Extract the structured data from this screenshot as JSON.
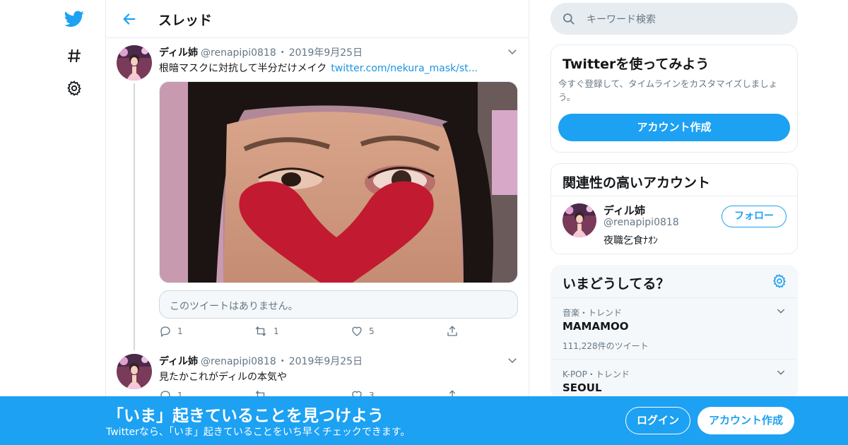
{
  "nav": {
    "icons": [
      "twitter-bird-icon",
      "hashtag-icon",
      "gear-icon"
    ]
  },
  "header": {
    "title": "スレッド"
  },
  "tweets": [
    {
      "name": "ディル姉",
      "handle": "@renapipi0818",
      "separator": "・",
      "date": "2019年9月25日",
      "text": "根暗マスクに対抗して半分だけメイク",
      "link": "twitter.com/nekura_mask/st...",
      "quote_unavailable": "このツイートはありません。",
      "replies": "1",
      "retweets": "1",
      "likes": "5"
    },
    {
      "name": "ディル姉",
      "handle": "@renapipi0818",
      "separator": "・",
      "date": "2019年9月25日",
      "text": "見たかこれがディルの本気や",
      "replies": "1",
      "retweets": "",
      "likes": "3"
    }
  ],
  "search": {
    "placeholder": "キーワード検索"
  },
  "signup_card": {
    "title": "Twitterを使ってみよう",
    "desc_line1": "今すぐ登録して、タイムラインをカスタマイズしましょ",
    "desc_line2": "う。",
    "button": "アカウント作成"
  },
  "related": {
    "title": "関連性の高いアカウント",
    "account": {
      "name": "ディル姉",
      "handle": "@renapipi0818",
      "bio": "夜職乞食ﾅｵﾝ",
      "follow": "フォロー"
    }
  },
  "trends": {
    "title": "いまどうしてる？",
    "items": [
      {
        "category": "音楽・トレンド",
        "name": "MAMAMOO",
        "count": "111,228件のツイート"
      },
      {
        "category": "K-POP・トレンド",
        "name": "SEOUL"
      }
    ]
  },
  "banner": {
    "title": "「いま」起きていることを見つけよう",
    "subtitle": "Twitterなら、「いま」起きていることをいち早くチェックできます。",
    "login": "ログイン",
    "signup": "アカウント作成"
  },
  "colors": {
    "accent": "#1da1f2",
    "muted": "#657786",
    "border": "#e6ecf0"
  }
}
